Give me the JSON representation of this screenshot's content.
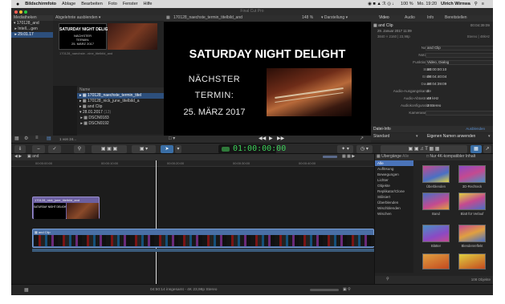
{
  "menubar": {
    "apple": "",
    "app_name": "Bildschirmfoto",
    "items": [
      "Ablage",
      "Bearbeiten",
      "Foto",
      "Fenster",
      "Hilfe"
    ],
    "battery": "100 %",
    "clock": "Mo. 19:20",
    "user": "Ulrich Wirnwa"
  },
  "window_title": "Final Cut Pro",
  "browser": {
    "header_left": "Mediatheken",
    "header_filter": "Alle Clips",
    "hide_rejected": "Abgelehnte ausblenden",
    "library_items": [
      {
        "label": "170128_and",
        "selected": false
      },
      {
        "label": "Intell....gen",
        "selected": false
      },
      {
        "label": "29.01.17",
        "selected": true
      }
    ],
    "event_thumb_caption": "170128_naechste...nine_titelbild_and",
    "list_header": "Name",
    "list_items": [
      {
        "label": "170128_naechste_termin_titel",
        "selected": true
      },
      {
        "label": "170128_nick_june_titelbild_a",
        "selected": false
      },
      {
        "label": "and Clip",
        "selected": false
      },
      {
        "label": "28.01.2017",
        "count": "(13)",
        "selected": false
      },
      {
        "label": "DSCN0183",
        "selected": false
      },
      {
        "label": "DSCN0192",
        "selected": false
      }
    ],
    "footer_count": "1 von 24..."
  },
  "viewer": {
    "clip_name": "170128_naechste_termin_titelbild_and",
    "zoom": "148 %",
    "display_label": "Darstellung",
    "title_line": "SATURDAY NIGHT DELIGHT",
    "line2": "NÄCHSTER",
    "line3": "TERMIN:",
    "line4": "25. MÄRZ 2017"
  },
  "inspector": {
    "tabs": [
      "Video",
      "Audio",
      "Info",
      "Bereitstellen"
    ],
    "clip_title": "and Clip",
    "clip_duration": "00:04:39:09",
    "date_line": "29. Januar 2017 11:09",
    "format_line": "3840 × 2160 | 23,98p",
    "format_right": "Stereo | 48kHz",
    "fields": [
      {
        "key": "Name",
        "value": "and Clip"
      },
      {
        "key": "Notizen",
        "value": ""
      },
      {
        "key": "Funktionen",
        "value": "Video, Dialog"
      },
      {
        "key": "Start",
        "value": "00:00:00:10"
      },
      {
        "key": "Ende",
        "value": "00:04:40:04"
      },
      {
        "key": "Dauer",
        "value": "00:04:39:09"
      },
      {
        "key": "Audio-Ausgangskanäle",
        "value": "2"
      },
      {
        "key": "Audio-Abtastrate",
        "value": "48 kHz"
      },
      {
        "key": "Audiokonfiguration",
        "value": "2 Stereo"
      },
      {
        "key": "Kameraname",
        "value": ""
      }
    ],
    "footer_title": "Datei-Info",
    "footer_action": "Ausblenden",
    "footer_select": "Standard",
    "footer_button": "Eigenen Namen anwenden"
  },
  "toolbar": {
    "timecode": "01:00:00:00"
  },
  "timeline": {
    "project_name": "and",
    "ruler": [
      "00:00:00:00",
      "00:00:10:00",
      "00:00:20:00",
      "00:00:30:00",
      "00:00:40:00"
    ],
    "title_clip": "170128_nick_june_titelbild_and",
    "main_clip": "and Clip",
    "status": "04:50:14 insgesamt - 4K 23,98p Stereo"
  },
  "effects": {
    "header_left": "Übergänge",
    "header_all": "Alle",
    "header_right": "Nur 4K-kompatibler Inhalt",
    "categories": [
      "Alle",
      "Auflösung",
      "Bewegungen",
      "Lichter",
      "Objekte",
      "Replikator/Clone",
      "Stilisiert",
      "Überblenden",
      "Wischblenden",
      "Wischen"
    ],
    "tiles": [
      "Überblenden",
      "3D-Rechteck",
      "Band",
      "Blatt für Verlauf",
      "Blätter",
      "Blendenreflekt",
      "",
      ""
    ],
    "count": "108 Objekte"
  },
  "colors": {
    "selection": "#2d4f7c",
    "accent_blue": "#3a6ea5",
    "clip_video": "#4a6fa5",
    "clip_title": "#6b5fa0",
    "timecode_green": "#3ecf5a"
  }
}
